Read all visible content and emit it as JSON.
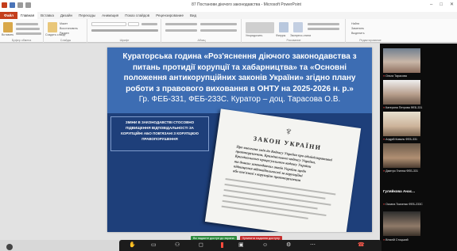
{
  "window": {
    "title": "87 Постанови діючого законодавства - Microsoft PowerPoint",
    "controls": [
      "–",
      "□",
      "✕"
    ]
  },
  "ribbon": {
    "tabs": [
      "Файл",
      "Главная",
      "Вставка",
      "Дизайн",
      "Переходы",
      "Анимация",
      "Показ слайдов",
      "Рецензирование",
      "Вид"
    ],
    "active_tab": "Главная",
    "groups": [
      "Буфер обмена",
      "Слайды",
      "Шрифт",
      "Абзац",
      "Рисование",
      "Редактирование"
    ],
    "buttons": {
      "paste": "Вставить",
      "new_slide": "Создать слайд",
      "layout": "Макет",
      "reset": "Восстановить",
      "section": "Раздел",
      "shapes": "Фигуры",
      "arrange": "Упорядочить",
      "quick_styles": "Экспресс-стили",
      "find": "Найти",
      "replace": "Заменить",
      "select": "Выделить"
    }
  },
  "slide": {
    "header_lines": [
      "Кураторська година «Роз'яснення діючого законодавства з",
      "питань протидії корупції та хабарництва» та «Основні",
      "положення антикорупційних законів України» згідно плану",
      "роботи з правового виховання в ОНТУ на 2025-2026 н. р.»"
    ],
    "header_subline": "Гр. ФЕБ-331, ФЕБ-233С. Куратор – доц. Тарасова О.В.",
    "body_caption": "Зміни в законодавстві стосовно підвищення відповідальності за корупційні або пов'язані з корупцією правопорушення",
    "document": {
      "emblem": "♆",
      "title": "ЗАКОН УКРАЇНИ",
      "lines": [
        "Про внесення змін до Кодексу України про адміністративні",
        "правопорушення, Кримінального кодексу України,",
        "Кримінального процесуального кодексу України",
        "та деяких законодавчих актів України щодо",
        "підвищення відповідальності за корупційні",
        "або пов'язані з корупцією правопорушення"
      ]
    }
  },
  "share_bar": {
    "sharing_label": "Ви надаєте доступ до екрана",
    "stop_label": "Зупинити надання доступу"
  },
  "participants": {
    "tiles": [
      {
        "name": "Ольга Тарасова"
      },
      {
        "name": "Катерина Петрова ФЕБ-331"
      },
      {
        "name": "Андрій Коваль ФЕБ-331"
      },
      {
        "name": "Дмитро Гнатюк ФЕБ-331"
      },
      {
        "name": "Оксана Ткаченко ФЕБ-233С"
      },
      {
        "name": "Віталій Стоцький"
      }
    ],
    "host_name": "Гуляйкова Анас..."
  },
  "colors": {
    "slide_header": "#3d6db3",
    "slide_body": "#1e3f7a",
    "file_tab": "#c43e1c",
    "share_green": "#2e8b3e",
    "share_red": "#c62f2f"
  },
  "icons": {
    "meeting_toolbar": [
      "hand-icon",
      "camera-icon",
      "participants-icon",
      "chat-icon",
      "share-icon",
      "reactions-icon",
      "settings-icon",
      "more-icon",
      "leave-icon"
    ]
  }
}
